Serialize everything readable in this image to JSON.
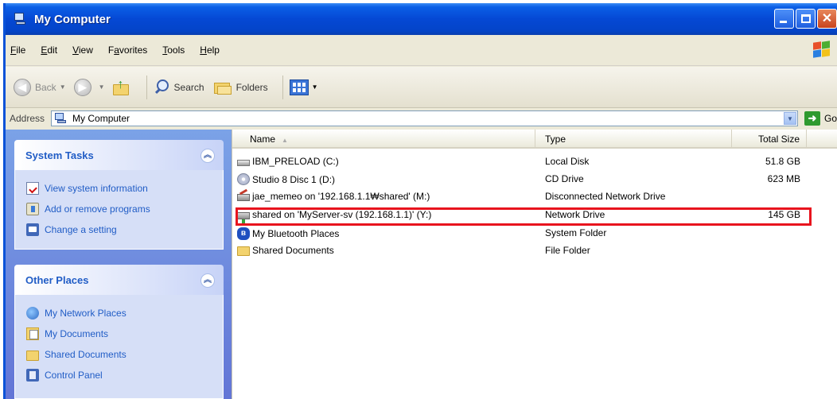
{
  "window": {
    "title": "My Computer"
  },
  "menu": [
    {
      "pre": "",
      "u": "F",
      "post": "ile"
    },
    {
      "pre": "",
      "u": "E",
      "post": "dit"
    },
    {
      "pre": "",
      "u": "V",
      "post": "iew"
    },
    {
      "pre": "F",
      "u": "a",
      "post": "vorites"
    },
    {
      "pre": "",
      "u": "T",
      "post": "ools"
    },
    {
      "pre": "",
      "u": "H",
      "post": "elp"
    }
  ],
  "toolbar": {
    "back": "Back",
    "search": "Search",
    "folders": "Folders"
  },
  "address": {
    "label": "Address",
    "value": "My Computer",
    "go": "Go"
  },
  "system_tasks": {
    "title": "System Tasks",
    "items": [
      "View system information",
      "Add or remove programs",
      "Change a setting"
    ]
  },
  "other_places": {
    "title": "Other Places",
    "items": [
      "My Network Places",
      "My Documents",
      "Shared Documents",
      "Control Panel"
    ]
  },
  "columns": {
    "name": "Name",
    "type": "Type",
    "total_size": "Total Size",
    "free": "Fr"
  },
  "rows": [
    {
      "name": "IBM_PRELOAD (C:)",
      "type": "Local Disk",
      "size": "51.8 GB",
      "icon": "hard-disk-icon"
    },
    {
      "name": "Studio 8 Disc 1 (D:)",
      "type": "CD Drive",
      "size": "623 MB",
      "icon": "cd-drive-icon"
    },
    {
      "name": "jae_memeo on '192.168.1.1₩shared' (M:)",
      "type": "Disconnected Network Drive",
      "size": "",
      "icon": "disconnected-network-drive-icon"
    },
    {
      "name": "shared on 'MyServer-sv (192.168.1.1)' (Y:)",
      "type": "Network Drive",
      "size": "145 GB",
      "icon": "network-drive-icon"
    },
    {
      "name": "My Bluetooth Places",
      "type": "System Folder",
      "size": "",
      "icon": "bluetooth-icon"
    },
    {
      "name": "Shared Documents",
      "type": "File Folder",
      "size": "",
      "icon": "folder-icon"
    }
  ],
  "colors": {
    "highlight": "#e8141e",
    "titlebar": "#0548d4",
    "link": "#215dc6"
  }
}
